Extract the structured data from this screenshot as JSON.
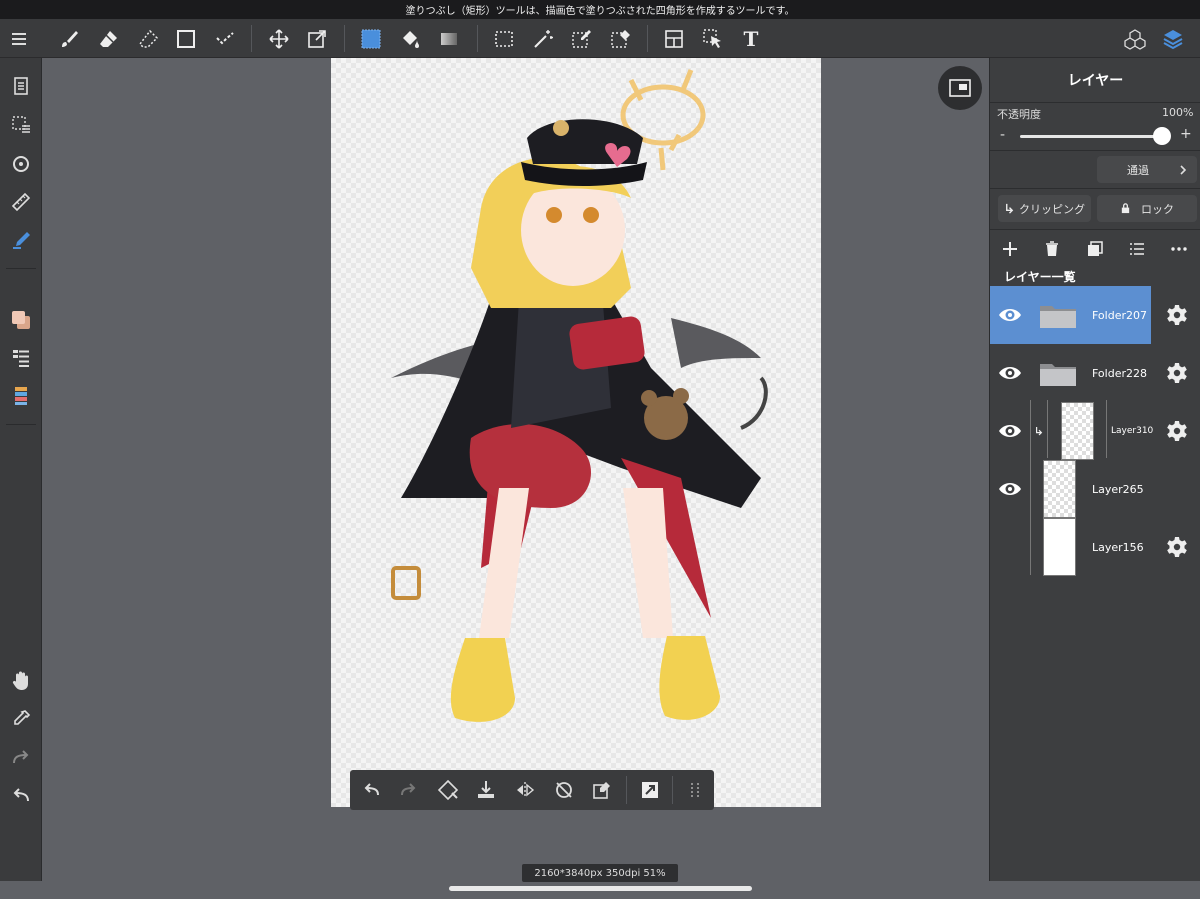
{
  "status_bar": {
    "hint": "塗りつぶし（矩形）ツールは、描画色で塗りつぶされた四角形を作成するツールです。"
  },
  "toolbar": {
    "icons": [
      "menu-icon",
      "brush-icon",
      "eraser-icon",
      "blur-icon",
      "rectangle-shape-icon",
      "dot-line-icon",
      "move-icon",
      "transform-icon",
      "fill-rect-icon",
      "bucket-icon",
      "gradient-icon",
      "select-rect-icon",
      "magic-wand-icon",
      "select-pen-icon",
      "select-eraser-icon",
      "frame-icon",
      "select-object-icon",
      "text-icon",
      "materials-icon",
      "layers-icon"
    ],
    "text_tool": "T"
  },
  "left_sidebar": {
    "icons": [
      "pages-icon",
      "selection-icon",
      "snap-icon",
      "ruler-icon",
      "pen-highlight-icon",
      "color-swatch-icon",
      "layer-list-icon",
      "palette-icon",
      "hand-icon",
      "eyedropper-icon",
      "redo-icon",
      "undo-icon"
    ]
  },
  "bottom_bar": {
    "icons": [
      "undo-icon",
      "redo-icon",
      "transform-icon",
      "import-icon",
      "flip-icon",
      "rotate-icon",
      "clear-icon",
      "fit-icon",
      "grid-icon"
    ]
  },
  "canvas_info": "2160*3840px 350dpi 51%",
  "layer_panel": {
    "title": "レイヤー",
    "opacity_label": "不透明度",
    "opacity_value": "100%",
    "opacity_level": 100,
    "minus": "-",
    "plus": "+",
    "blend_mode": "通過",
    "clipping_label": "クリッピング",
    "lock_label": "ロック",
    "list_title": "レイヤー一覧",
    "layers": [
      {
        "name": "Folder207",
        "type": "folder",
        "visible": true,
        "selected": true
      },
      {
        "name": "Folder228",
        "type": "folder",
        "visible": true,
        "selected": false
      },
      {
        "name": "Layer310",
        "type": "layer",
        "visible": true,
        "selected": false,
        "clipped": true
      },
      {
        "name": "Layer265",
        "type": "layer",
        "visible": true,
        "selected": false
      },
      {
        "name": "Layer156",
        "type": "layer",
        "visible": false,
        "selected": false
      }
    ]
  },
  "colors": {
    "accent": "#5c8fd1",
    "toolbar": "#3a3b3d",
    "workspace": "#5f6166"
  }
}
